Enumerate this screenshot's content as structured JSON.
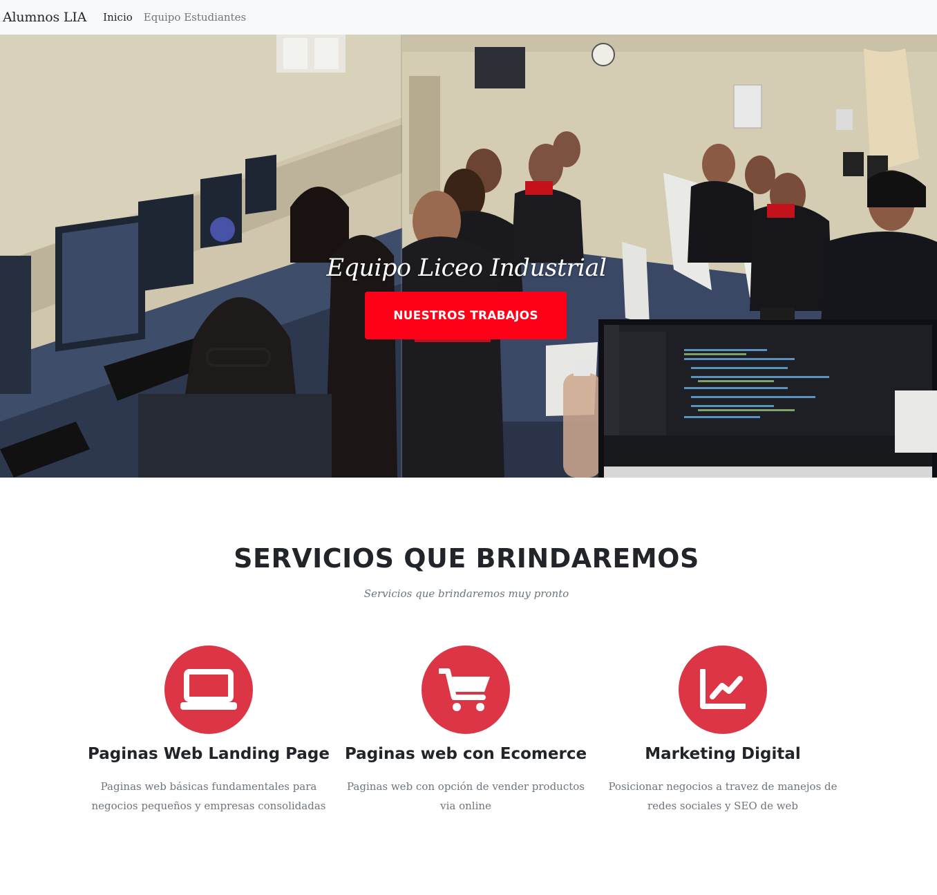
{
  "navbar": {
    "brand": "Alumnos LIA",
    "links": [
      {
        "label": "Inicio",
        "active": true
      },
      {
        "label": "Equipo Estudiantes",
        "active": false
      }
    ]
  },
  "hero": {
    "title": "Equipo Liceo Industrial",
    "button_label": "NUESTROS TRABAJOS",
    "button_color": "#ff0019",
    "background": "classroom-photo-students-at-computers"
  },
  "services": {
    "title": "SERVICIOS QUE BRINDAREMOS",
    "subtitle": "Servicios que brindaremos muy pronto",
    "accent_color": "#dc3545",
    "items": [
      {
        "icon": "laptop-icon",
        "title": "Paginas Web Landing Page",
        "description": "Paginas web básicas fundamentales para negocios pequeños y empresas consolidadas"
      },
      {
        "icon": "shopping-cart-icon",
        "title": "Paginas web con Ecomerce",
        "description": "Paginas web con opción de vender productos via online"
      },
      {
        "icon": "chart-line-icon",
        "title": "Marketing Digital",
        "description": "Posicionar negocios a travez de manejos de redes sociales y SEO de web"
      }
    ]
  }
}
